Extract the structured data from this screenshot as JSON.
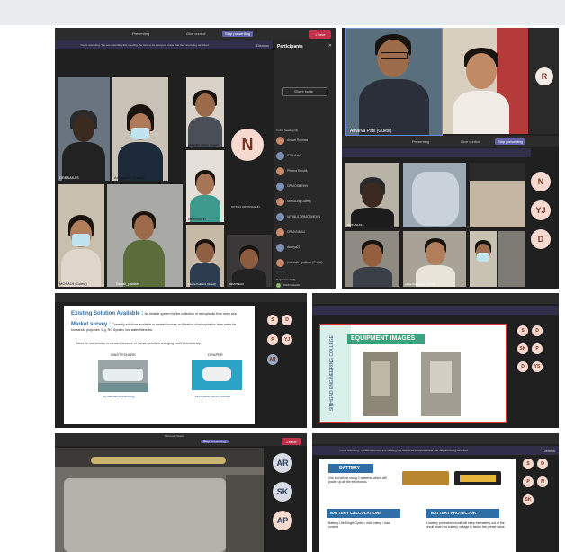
{
  "panel_tl": {
    "top_bar": {
      "presenting": "Presenting",
      "give_control": "Give control",
      "stop_presenting": "Stop presenting",
      "leave": "Leave"
    },
    "recording_banner": "You're recording. You are recording this meeting. Be sure to let everyone know that they are being recorded.",
    "dismiss": "Dismiss",
    "participants": {
      "title": "Participants",
      "share_invite": "Share invite",
      "in_meeting": "In this meeting (9)",
      "items": [
        "Ansari Ramida",
        "STM Amal",
        "Pihana Shrutik",
        "DRMOSHEHN",
        "MOSA19 (Guest)",
        "NITINL0 DRMOSHEHN",
        "DRMVNEAU",
        "Ameya20",
        "palkantha pathan (Guest)"
      ],
      "suggestions": "Suggestions (4)",
      "suggested_item": "DIMOSHAHN"
    },
    "tiles": [
      "DRBSAKAS",
      "Amayaa12 (Guest)",
      "palkantha pathan (Guest)",
      "DRMOSHEHN",
      "MOSA19 (Guest)",
      "Dezall_paniste",
      "Meera Kulkarni (Guest)",
      "DRMVNEAU"
    ],
    "big_avatar": "N",
    "big_avatar_name": "NITINL0 DRMOSHEHN"
  },
  "panel_tr": {
    "video_label": "Atharva Patil (Guest)",
    "avatar_letter": "R",
    "top_bar": {
      "presenting": "Presenting",
      "give_control": "Give control",
      "stop_presenting": "Stop presenting"
    },
    "side_avatars": [
      "N",
      "YJ",
      "D"
    ],
    "tiles": [
      "DRBSAKAS",
      "palkantha pathan (Guest)"
    ]
  },
  "panel_ml": {
    "title_line1_bold": "Existing Solution Available :",
    "title_line1_rest": "No reliable system for the collection of microplastic from deep sea.",
    "title_line2_bold": "Market survey :",
    "title_line2_rest": "Currently solutions available in market focuses on filtration of microplastics from water for household purposes. E.g. RO System, low water filters etc.",
    "title_line3": "Need for our solution is created because of human activities changing earth's biodiversity.",
    "img1_title": "WASTESHARK",
    "img1_caption": "By Ranmarine Technology",
    "img2_title": "DRAPER",
    "img2_caption": "Micro plastic Sensor Concept",
    "avatars": [
      "S",
      "D",
      "P",
      "YJ",
      "AR"
    ]
  },
  "panel_mr": {
    "slide_title": "EQUIPMENT IMAGES",
    "vertical_text": "SINHGAD ENGINEERING COLLEGE",
    "avatars": [
      "S",
      "D",
      "SK",
      "P",
      "D",
      "YS"
    ]
  },
  "panel_bl": {
    "title": "Microsoft Teams",
    "stop_presenting": "Stop presenting",
    "leave": "Leave",
    "avatars": [
      "AR",
      "SK",
      "AP"
    ]
  },
  "panel_br": {
    "recording_banner": "You're recording. You are recording this meeting. Be sure to let everyone know that they are being recorded.",
    "dismiss": "Dismiss",
    "battery_title": "BATTERY",
    "battery_text": "Our bot will be using 2 batteries which will power up all the electronics.",
    "battery_calc_title": "BATTERY CALCULATIONS",
    "battery_calc_text": "Battery Life Single Cycle = mAh rating / load current",
    "battery_prot_title": "BATTERY PROTECTOR",
    "battery_prot_text": "A battery protection circuit will keep the battery out of the circuit when the battery voltage is below the preset value.",
    "avatars": [
      "S",
      "D",
      "P",
      "N",
      "SK"
    ]
  },
  "colors": {
    "teams_dark": "#1f1f1f",
    "leave_red": "#c4314b",
    "avatar_bg": "#f6d9cf",
    "avatar_fg": "#7a2f21",
    "slide_blue": "#2f6ea6"
  }
}
